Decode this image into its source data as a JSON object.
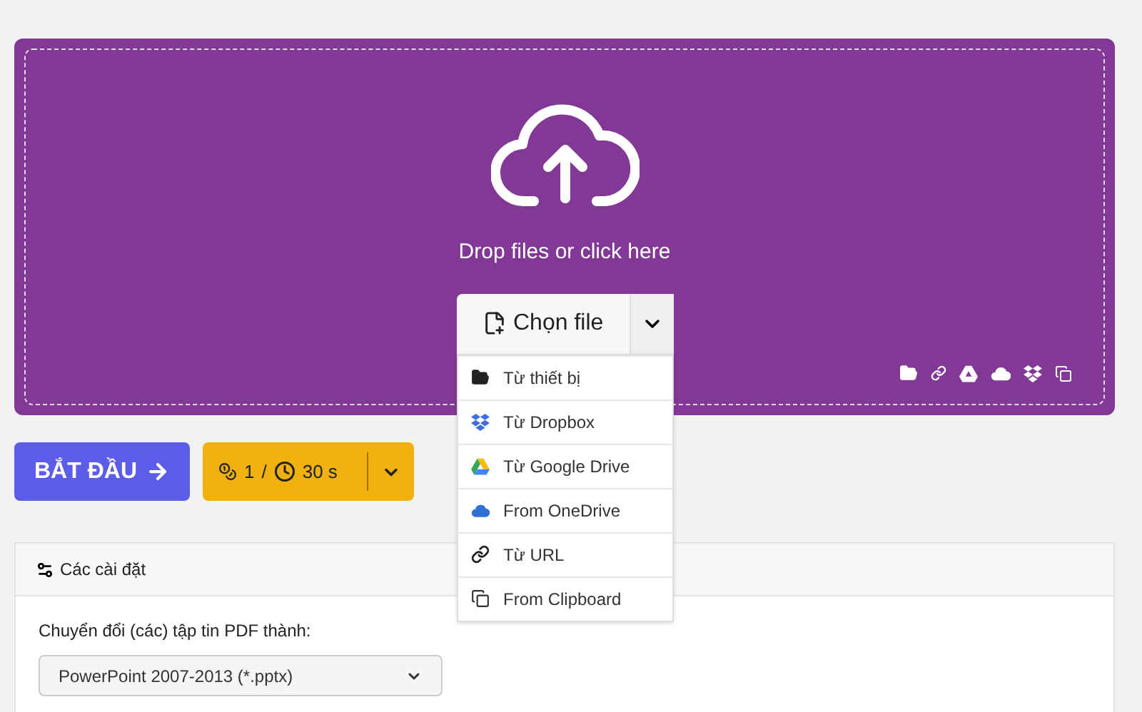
{
  "dropzone": {
    "prompt": "Drop files or click here",
    "choose_button": {
      "label": "Chọn file",
      "expanded": true
    }
  },
  "source_menu": [
    {
      "kind": "device",
      "label": "Từ thiết bị"
    },
    {
      "kind": "dropbox",
      "label": "Từ Dropbox"
    },
    {
      "kind": "gdrive",
      "label": "Từ Google Drive"
    },
    {
      "kind": "onedrive",
      "label": "From OneDrive"
    },
    {
      "kind": "url",
      "label": "Từ URL"
    },
    {
      "kind": "clipboard",
      "label": "From Clipboard"
    }
  ],
  "start_button": {
    "label": "BẮT ĐẦU"
  },
  "cost_button": {
    "credits": "1",
    "separator": "/",
    "time": "30 s"
  },
  "settings": {
    "title": "Các cài đặt",
    "field_label": "Chuyển đổi (các) tập tin PDF thành:",
    "format": "PowerPoint 2007-2013 (*.pptx)"
  }
}
